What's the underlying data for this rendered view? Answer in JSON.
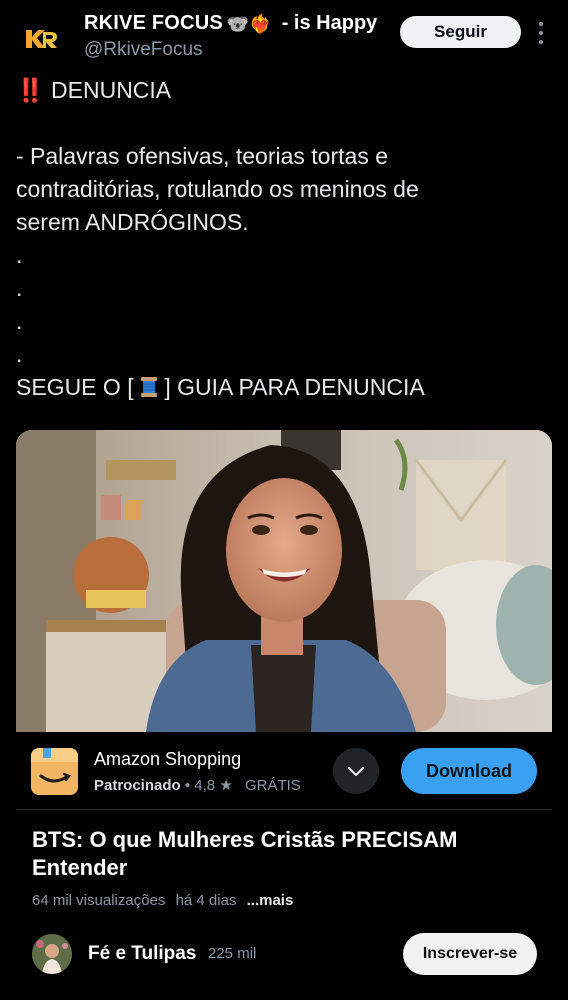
{
  "tweet": {
    "author": {
      "display_name": "RKIVE FOCUS",
      "emojis": "🐨❤️‍🔥",
      "status": "- is Happy",
      "handle": "@RkiveFocus",
      "follow_label": "Seguir"
    },
    "text_lines": [
      "DENUNCIA",
      "",
      "- Palavras ofensivas, teorias tortas e",
      "contraditórias, rotulando os meninos de",
      "serem ANDRÓGINOS.",
      ".",
      ".",
      ".",
      ".",
      "SEGUE O [",
      "] GUIA PARA DENUNCIA"
    ],
    "text_prefix_emoji": "‼️",
    "icons": [
      "rkive-logo",
      "more-icon",
      "thread-spool-icon",
      "chevron-down-icon",
      "star-icon"
    ]
  },
  "ad": {
    "app_name": "Amazon Shopping",
    "sponsored_label": "Patrocinado",
    "rating": "4,8",
    "price": "GRÁTIS",
    "download_label": "Download"
  },
  "video": {
    "title": "BTS: O que Mulheres Cristãs PRECISAM Entender",
    "views": "64 mil visualizações",
    "age": "há 4 dias",
    "more_label": "...mais",
    "channel_name": "Fé e Tulipas",
    "subscribers": "225 mil",
    "subscribe_label": "Inscrever-se"
  },
  "colors": {
    "background": "#000000",
    "accent_blue": "#3aa0f2",
    "alert_red": "#f4212e",
    "secondary_text": "#8b98a5"
  }
}
